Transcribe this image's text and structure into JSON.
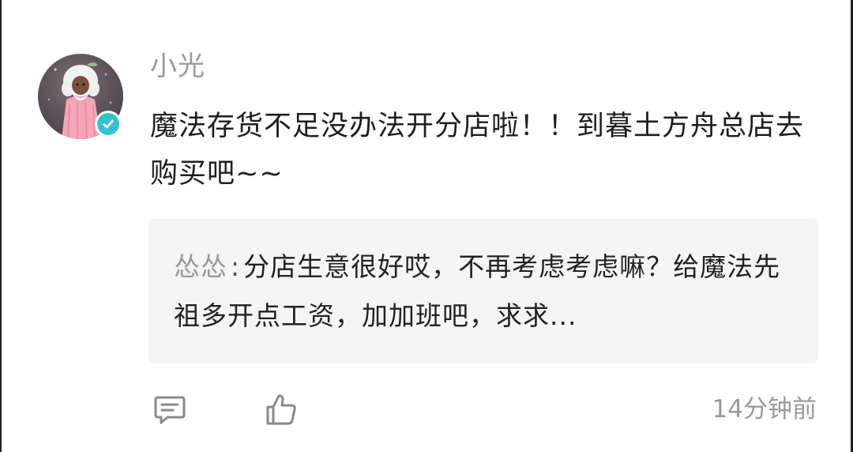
{
  "comment": {
    "username": "小光",
    "text": "魔法存货不足没办法开分店啦！！到暮土方舟总店去购买吧~~",
    "verified": true,
    "timestamp": "14分钟前"
  },
  "reply": {
    "author": "怂怂",
    "separator": ":",
    "text": "分店生意很好哎，不再考虑考虑嘛？给魔法先祖多开点工资，加加班吧，求求..."
  },
  "actions": {
    "comment_icon": "comment-icon",
    "like_icon": "thumbs-up-icon"
  },
  "colors": {
    "username": "#9a9a9a",
    "text": "#1e1e1e",
    "reply_bg": "#f5f5f5",
    "verified_badge": "#33c1d3"
  }
}
